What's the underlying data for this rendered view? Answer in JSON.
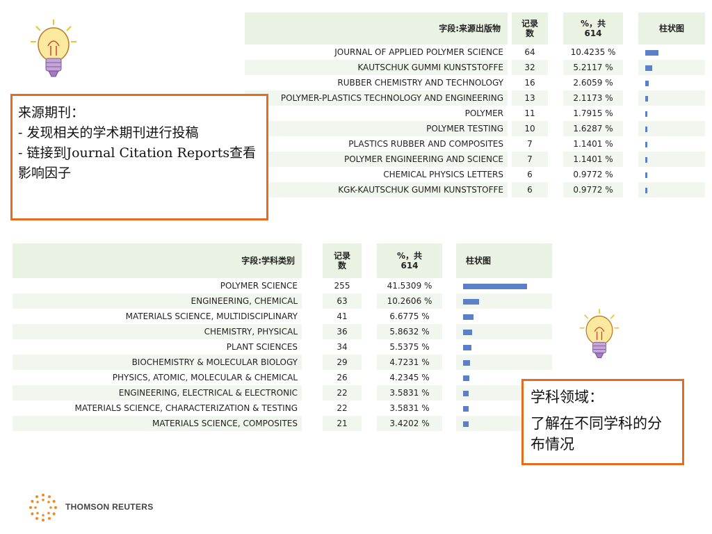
{
  "source_table": {
    "headers": {
      "field": "字段:来源出版物",
      "count": "记录\n数",
      "percent": "%，共\n614",
      "bar": "柱状图"
    },
    "rows": [
      {
        "name": "JOURNAL OF APPLIED POLYMER SCIENCE",
        "count": "64",
        "percent": "10.4235 %",
        "bar_fraction": 0.2511
      },
      {
        "name": "KAUTSCHUK GUMMI KUNSTSTOFFE",
        "count": "32",
        "percent": "5.2117 %",
        "bar_fraction": 0.1255
      },
      {
        "name": "RUBBER CHEMISTRY AND TECHNOLOGY",
        "count": "16",
        "percent": "2.6059 %",
        "bar_fraction": 0.0627
      },
      {
        "name": "POLYMER-PLASTICS TECHNOLOGY AND ENGINEERING",
        "count": "13",
        "percent": "2.1173 %",
        "bar_fraction": 0.051
      },
      {
        "name": "POLYMER",
        "count": "11",
        "percent": "1.7915 %",
        "bar_fraction": 0.0431
      },
      {
        "name": "POLYMER TESTING",
        "count": "10",
        "percent": "1.6287 %",
        "bar_fraction": 0.0392
      },
      {
        "name": "PLASTICS RUBBER AND COMPOSITES",
        "count": "7",
        "percent": "1.1401 %",
        "bar_fraction": 0.0275
      },
      {
        "name": "POLYMER ENGINEERING AND SCIENCE",
        "count": "7",
        "percent": "1.1401 %",
        "bar_fraction": 0.0275
      },
      {
        "name": "CHEMICAL PHYSICS LETTERS",
        "count": "6",
        "percent": "0.9772 %",
        "bar_fraction": 0.0235
      },
      {
        "name": "KGK-KAUTSCHUK GUMMI KUNSTSTOFFE",
        "count": "6",
        "percent": "0.9772 %",
        "bar_fraction": 0.0235
      }
    ]
  },
  "subject_table": {
    "headers": {
      "field": "字段:学科类别",
      "count": "记录\n数",
      "percent": "%，共\n614",
      "bar": "柱状图"
    },
    "rows": [
      {
        "name": "POLYMER SCIENCE",
        "count": "255",
        "percent": "41.5309 %",
        "bar_fraction": 1.0
      },
      {
        "name": "ENGINEERING, CHEMICAL",
        "count": "63",
        "percent": "10.2606 %",
        "bar_fraction": 0.247
      },
      {
        "name": "MATERIALS SCIENCE, MULTIDISCIPLINARY",
        "count": "41",
        "percent": "6.6775 %",
        "bar_fraction": 0.161
      },
      {
        "name": "CHEMISTRY, PHYSICAL",
        "count": "36",
        "percent": "5.8632 %",
        "bar_fraction": 0.141
      },
      {
        "name": "PLANT SCIENCES",
        "count": "34",
        "percent": "5.5375 %",
        "bar_fraction": 0.133
      },
      {
        "name": "BIOCHEMISTRY & MOLECULAR BIOLOGY",
        "count": "29",
        "percent": "4.7231 %",
        "bar_fraction": 0.114
      },
      {
        "name": "PHYSICS, ATOMIC, MOLECULAR & CHEMICAL",
        "count": "26",
        "percent": "4.2345 %",
        "bar_fraction": 0.102
      },
      {
        "name": "ENGINEERING, ELECTRICAL & ELECTRONIC",
        "count": "22",
        "percent": "3.5831 %",
        "bar_fraction": 0.086
      },
      {
        "name": "MATERIALS SCIENCE, CHARACTERIZATION & TESTING",
        "count": "22",
        "percent": "3.5831 %",
        "bar_fraction": 0.086
      },
      {
        "name": "MATERIALS SCIENCE, COMPOSITES",
        "count": "21",
        "percent": "3.4202 %",
        "bar_fraction": 0.082
      }
    ]
  },
  "callout_source": {
    "title": "来源期刊：",
    "line1": "- 发现相关的学术期刊进行投稿",
    "line2": "- 链接到Journal Citation Reports查看影响因子"
  },
  "callout_subject": {
    "title": "学科领域：",
    "body": "了解在不同学科的分布情况"
  },
  "footer": {
    "logo_text": "THOMSON REUTERS"
  },
  "icons": {
    "bulb": "lightbulb-icon",
    "logo": "thomson-reuters-logo-icon"
  },
  "colors": {
    "accent_border": "#e46c1f",
    "bar": "#5b80c8",
    "header_bg": "#e9f2e3"
  }
}
